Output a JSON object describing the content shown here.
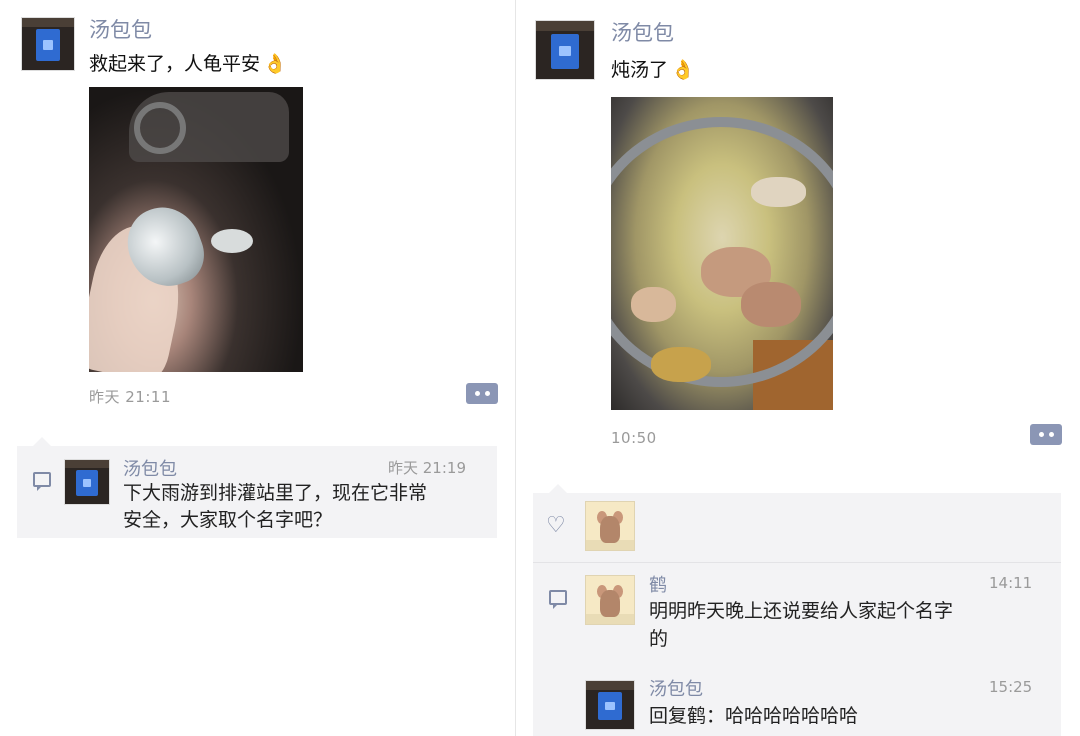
{
  "left_post": {
    "author": "汤包包",
    "text": "救起来了，人龟平安",
    "emoji": "👌",
    "time": "昨天 21:11",
    "comment": {
      "author": "汤包包",
      "time": "昨天 21:19",
      "line1": "下大雨游到排灌站里了，现在它非常",
      "line2": "安全，大家取个名字吧？"
    }
  },
  "right_post": {
    "author": "汤包包",
    "text": "炖汤了",
    "emoji": "👌",
    "time": "10:50",
    "comments": [
      {
        "author": "鹤",
        "time": "14:11",
        "line1": "明明昨天晚上还说要给人家起个名字",
        "line2": "的"
      },
      {
        "author": "汤包包",
        "time": "15:25",
        "line1": "回复鹤：哈哈哈哈哈哈哈",
        "line2": ""
      }
    ]
  },
  "icons": {
    "more": "more-dots-icon",
    "comment": "comment-icon",
    "like": "heart-icon",
    "ok": "ok-hand-icon"
  },
  "colors": {
    "name_blue": "#7f8aa6",
    "panel_bg": "#f3f3f5"
  }
}
